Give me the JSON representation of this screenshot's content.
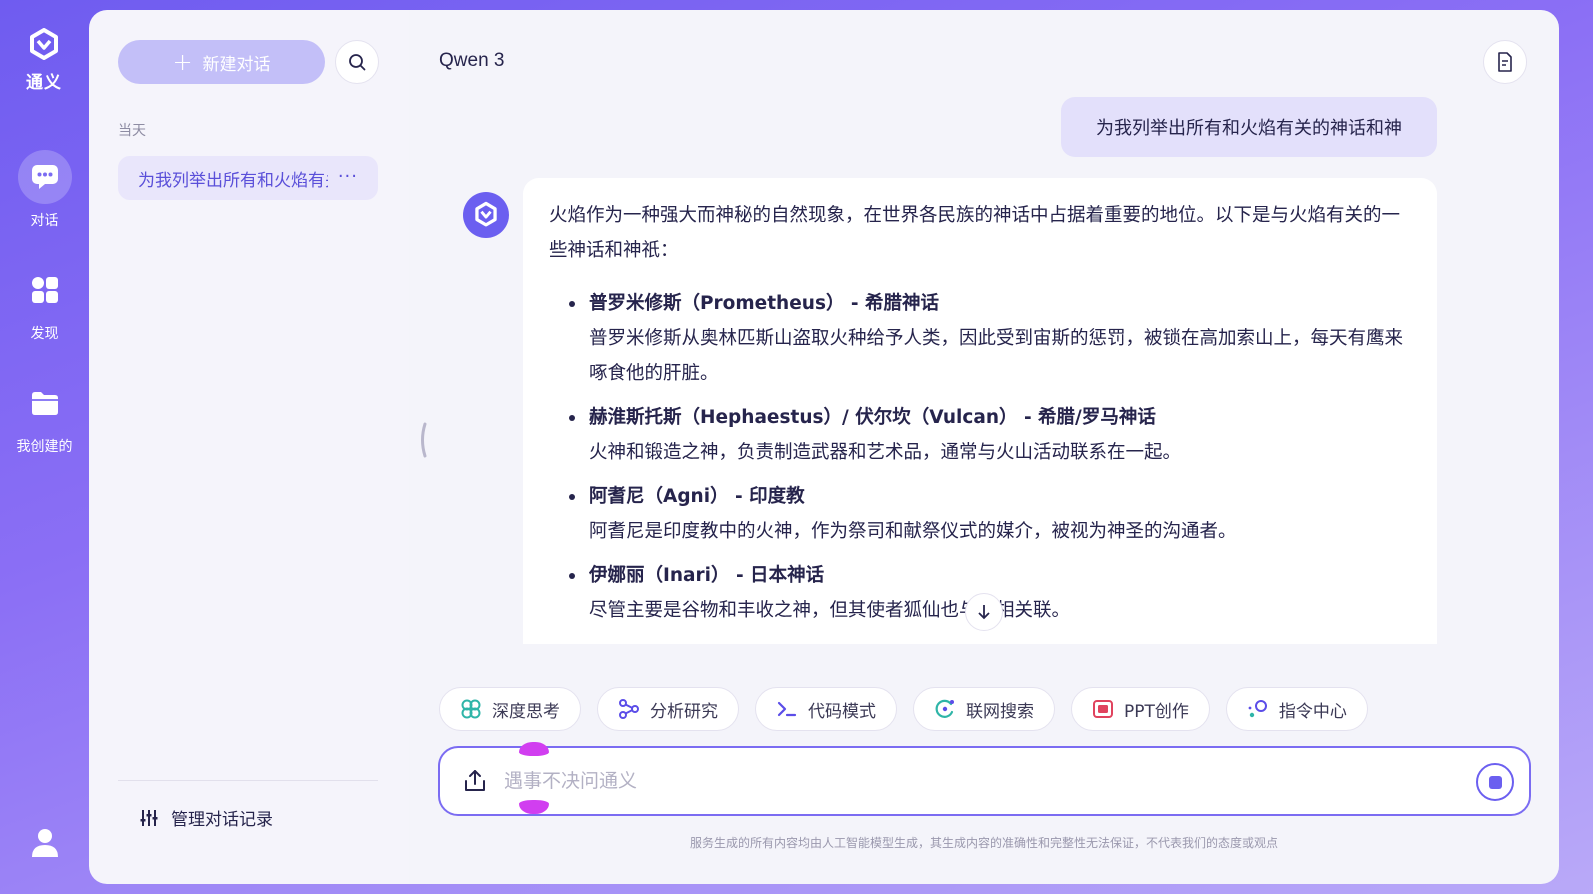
{
  "brand": {
    "name": "通义",
    "color": "#6b5ff0"
  },
  "rail": {
    "items": [
      {
        "label": "对话",
        "icon": "chat-bubble-icon",
        "active": true
      },
      {
        "label": "发现",
        "icon": "grid-apps-icon",
        "active": false
      },
      {
        "label": "我创建的",
        "icon": "folder-icon",
        "active": false
      }
    ],
    "user_icon": "user-icon"
  },
  "sidebar": {
    "new_chat_label": "新建对话",
    "section_label": "当天",
    "history": [
      {
        "title": "为我列举出所有和火焰有关的神话和神"
      }
    ],
    "more_label": "···",
    "manage_label": "管理对话记录"
  },
  "main": {
    "model_name": "Qwen 3",
    "user_message": "为我列举出所有和火焰有关的神话和神",
    "answer": {
      "intro": "火焰作为一种强大而神秘的自然现象，在世界各民族的神话中占据着重要的地位。以下是与火焰有关的一些神话和神祇：",
      "items": [
        {
          "title": "普罗米修斯（Prometheus） - 希腊神话",
          "desc": "普罗米修斯从奥林匹斯山盗取火种给予人类，因此受到宙斯的惩罚，被锁在高加索山上，每天有鹰来啄食他的肝脏。"
        },
        {
          "title": "赫淮斯托斯（Hephaestus）/ 伏尔坎（Vulcan） - 希腊/罗马神话",
          "desc": "火神和锻造之神，负责制造武器和艺术品，通常与火山活动联系在一起。"
        },
        {
          "title": "阿耆尼（Agni） - 印度教",
          "desc": "阿耆尼是印度教中的火神，作为祭司和献祭仪式的媒介，被视为神圣的沟通者。"
        },
        {
          "title": "伊娜丽（Inari） - 日本神话",
          "desc": "尽管主要是谷物和丰收之神，但其使者狐仙也与火相关联。"
        }
      ]
    },
    "tools": [
      {
        "label": "深度思考",
        "icon": "deep-think-icon"
      },
      {
        "label": "分析研究",
        "icon": "research-icon"
      },
      {
        "label": "代码模式",
        "icon": "code-icon"
      },
      {
        "label": "联网搜索",
        "icon": "web-search-icon"
      },
      {
        "label": "PPT创作",
        "icon": "ppt-icon"
      },
      {
        "label": "指令中心",
        "icon": "prompt-center-icon"
      }
    ],
    "input_placeholder": "遇事不决问通义",
    "disclaimer": "服务生成的所有内容均由人工智能模型生成，其生成内容的准确性和完整性无法保证，不代表我们的态度或观点"
  }
}
